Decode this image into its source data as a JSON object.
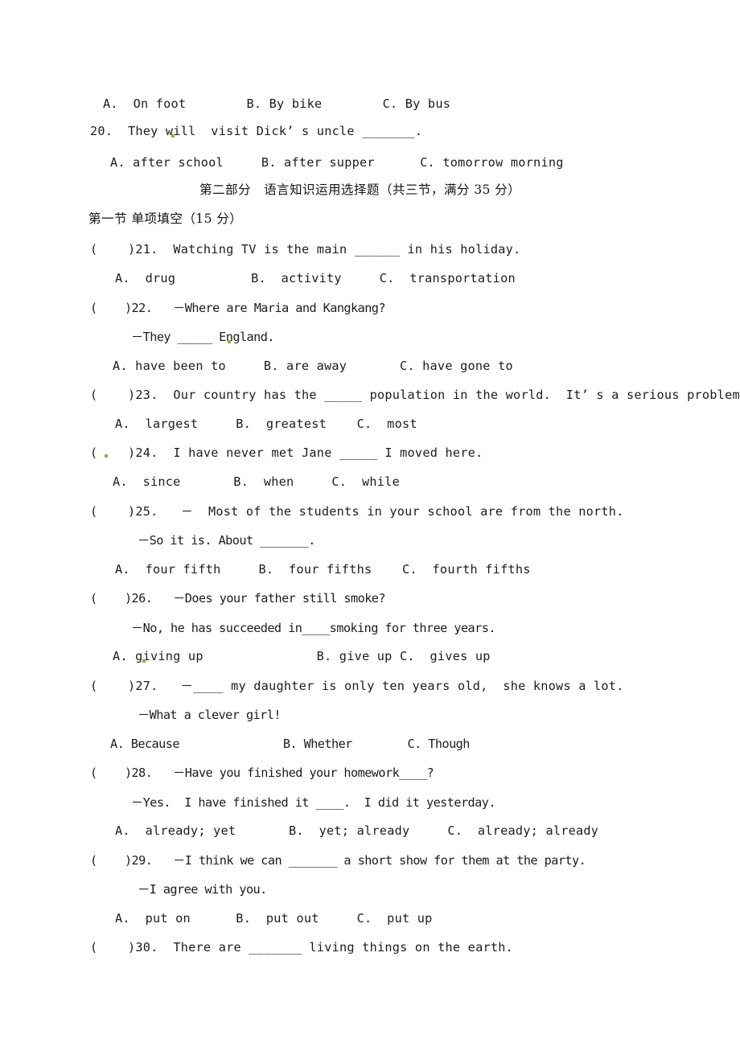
{
  "document": {
    "type": "exam-paper",
    "language": "zh-CN/en",
    "background_color": "#ffffff",
    "text_color": "#1c1c1c"
  },
  "q19_options": "A.  On foot        B. By bike        C. By bus",
  "q20": {
    "stem": "20.  They will  visit Dick’ s uncle _______.",
    "options": "A. after school     B. after supper      C. tomorrow morning"
  },
  "part_heading": "第二部分　语言知识运用选择题（共三节，满分 35 分）",
  "section_heading": "第一节 单项填空（15 分）",
  "questions": [
    {
      "marker": "(    )21.",
      "stem": "(    )21.  Watching TV is the main ______ in his holiday.",
      "lines": [],
      "options": "A.  drug          B.  activity     C.  transportation"
    },
    {
      "marker": "(    )22.",
      "stem": "(    )22.   －Where are Maria and Kangkang?",
      "lines": [
        "－They _____ England."
      ],
      "options": "A. have been to     B. are away       C. have gone to"
    },
    {
      "marker": "(    )23.",
      "stem": "(    )23.  Our country has the _____ population in the world.  It’ s a serious problem.",
      "lines": [],
      "options": "A.  largest     B.  greatest    C.  most"
    },
    {
      "marker": "(    )24.",
      "stem": "(    )24.  I have never met Jane _____ I moved here.",
      "lines": [],
      "options": "A.  since       B.  when     C.  while"
    },
    {
      "marker": "(    )25.",
      "stem": "(    )25.   －  Most of the students in your school are from the north.",
      "lines": [
        "－So it is. About _______."
      ],
      "options": "A.  four fifth     B.  four fifths    C.  fourth fifths"
    },
    {
      "marker": "(    )26.",
      "stem": "(    )26.   －Does your father still smoke?",
      "lines": [
        "－No, he has succeeded in____smoking for three years."
      ],
      "options": "A. giving up               B. give up C.  gives up"
    },
    {
      "marker": "(    )27.",
      "stem": "(    )27.   －____ my daughter is only ten years old,  she knows a lot.",
      "lines": [
        "－What a clever girl!"
      ],
      "options": "A. Because               B. Whether        C. Though"
    },
    {
      "marker": "(    )28.",
      "stem": "(    )28.   －Have you finished your homework____?",
      "lines": [
        "－Yes.  I have finished it ____.  I did it yesterday."
      ],
      "options": "A.  already; yet       B.  yet; already     C.  already; already"
    },
    {
      "marker": "(    )29.",
      "stem": "(    )29.   －I think we can _______ a short show for them at the party.",
      "lines": [
        "－I agree with you."
      ],
      "options": "A.  put on      B.  put out     C.  put up"
    },
    {
      "marker": "(    )30.",
      "stem": "(    )30.  There are _______ living things on the earth.",
      "lines": [],
      "options": ""
    }
  ]
}
